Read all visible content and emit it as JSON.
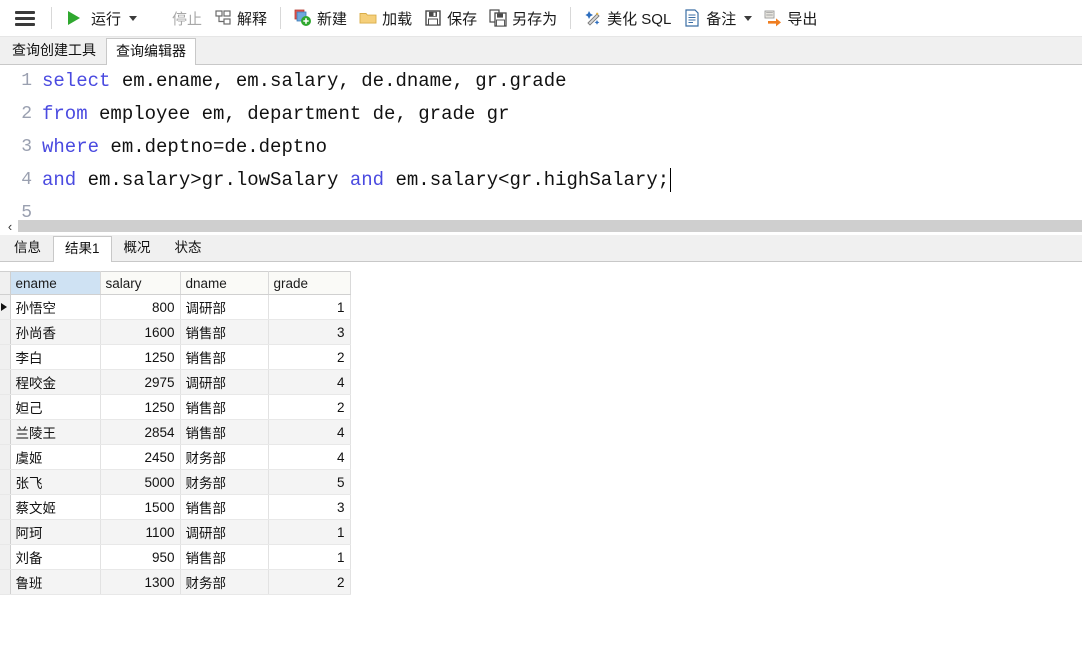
{
  "toolbar": {
    "menu_icon": "hamburger-menu-icon",
    "items": [
      {
        "label": "运行",
        "icon": "play-icon",
        "disabled": false,
        "caret": true
      },
      {
        "label": "停止",
        "icon": "stop-icon",
        "disabled": true,
        "caret": false
      },
      {
        "label": "解释",
        "icon": "explain-icon",
        "disabled": false,
        "caret": false
      },
      {
        "label": "新建",
        "icon": "new-icon",
        "disabled": false,
        "caret": false
      },
      {
        "label": "加载",
        "icon": "folder-icon",
        "disabled": false,
        "caret": false
      },
      {
        "label": "保存",
        "icon": "save-icon",
        "disabled": false,
        "caret": false
      },
      {
        "label": "另存为",
        "icon": "save-as-icon",
        "disabled": false,
        "caret": false
      },
      {
        "label": "美化 SQL",
        "icon": "beautify-icon",
        "disabled": false,
        "caret": false
      },
      {
        "label": "备注",
        "icon": "comment-icon",
        "disabled": false,
        "caret": true
      },
      {
        "label": "导出",
        "icon": "export-icon",
        "disabled": false,
        "caret": false
      }
    ]
  },
  "editor_tabs": [
    {
      "label": "查询创建工具",
      "active": false
    },
    {
      "label": "查询编辑器",
      "active": true
    }
  ],
  "sql": {
    "lines": [
      {
        "no": "1",
        "parts": [
          {
            "t": "select",
            "kw": true
          },
          {
            "t": " em.ename, em.salary, de.dname, gr.grade",
            "kw": false
          }
        ]
      },
      {
        "no": "2",
        "parts": [
          {
            "t": "from",
            "kw": true
          },
          {
            "t": " employee em, department de, grade gr",
            "kw": false
          }
        ]
      },
      {
        "no": "3",
        "parts": [
          {
            "t": "where",
            "kw": true
          },
          {
            "t": " em.deptno=de.deptno",
            "kw": false
          }
        ]
      },
      {
        "no": "4",
        "parts": [
          {
            "t": "and",
            "kw": true
          },
          {
            "t": " em.salary>gr.lowSalary ",
            "kw": false
          },
          {
            "t": "and",
            "kw": true
          },
          {
            "t": " em.salary<gr.highSalary;",
            "kw": false
          }
        ]
      },
      {
        "no": "5",
        "parts": []
      }
    ]
  },
  "splitter": {
    "collapse_label": "‹"
  },
  "result_tabs": [
    {
      "label": "信息",
      "active": false
    },
    {
      "label": "结果1",
      "active": true
    },
    {
      "label": "概况",
      "active": false
    },
    {
      "label": "状态",
      "active": false
    }
  ],
  "grid": {
    "columns": [
      {
        "key": "ename",
        "label": "ename",
        "align": "left",
        "selected": true
      },
      {
        "key": "salary",
        "label": "salary",
        "align": "right",
        "selected": false
      },
      {
        "key": "dname",
        "label": "dname",
        "align": "left",
        "selected": false
      },
      {
        "key": "grade",
        "label": "grade",
        "align": "right",
        "selected": false
      }
    ],
    "rows": [
      {
        "ename": "孙悟空",
        "salary": "800",
        "dname": "调研部",
        "grade": "1",
        "current": true
      },
      {
        "ename": "孙尚香",
        "salary": "1600",
        "dname": "销售部",
        "grade": "3",
        "current": false
      },
      {
        "ename": "李白",
        "salary": "1250",
        "dname": "销售部",
        "grade": "2",
        "current": false
      },
      {
        "ename": "程咬金",
        "salary": "2975",
        "dname": "调研部",
        "grade": "4",
        "current": false
      },
      {
        "ename": "妲己",
        "salary": "1250",
        "dname": "销售部",
        "grade": "2",
        "current": false
      },
      {
        "ename": "兰陵王",
        "salary": "2854",
        "dname": "销售部",
        "grade": "4",
        "current": false
      },
      {
        "ename": "虞姬",
        "salary": "2450",
        "dname": "财务部",
        "grade": "4",
        "current": false
      },
      {
        "ename": "张飞",
        "salary": "5000",
        "dname": "财务部",
        "grade": "5",
        "current": false
      },
      {
        "ename": "蔡文姬",
        "salary": "1500",
        "dname": "销售部",
        "grade": "3",
        "current": false
      },
      {
        "ename": "阿珂",
        "salary": "1100",
        "dname": "调研部",
        "grade": "1",
        "current": false
      },
      {
        "ename": "刘备",
        "salary": "950",
        "dname": "销售部",
        "grade": "1",
        "current": false
      },
      {
        "ename": "鲁班",
        "salary": "1300",
        "dname": "财务部",
        "grade": "2",
        "current": false
      }
    ]
  },
  "colors": {
    "keyword": "#4a4ae0",
    "selected_header": "#cfe2f3",
    "run_green": "#2fa82f",
    "export_orange": "#ef7e21"
  }
}
